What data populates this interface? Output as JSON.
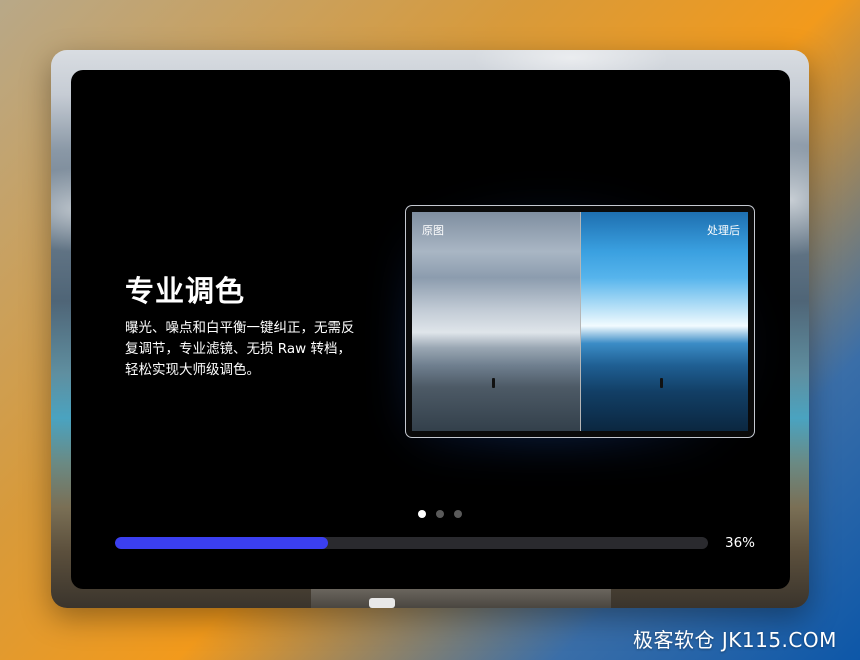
{
  "slide": {
    "title": "专业调色",
    "description": "曝光、噪点和白平衡一键纠正，无需反复调节，专业滤镜、无损 Raw 转档，轻松实现大师级调色。"
  },
  "comparison": {
    "before_label": "原图",
    "after_label": "处理后"
  },
  "carousel": {
    "total": 3,
    "active_index": 0
  },
  "progress": {
    "percent": 36,
    "text": "36%"
  },
  "watermark": {
    "text": "极客软仓 JK115.COM"
  },
  "colors": {
    "accent": "#3b3ff0",
    "panel_background": "#000000",
    "dot_active": "#ffffff",
    "dot_inactive": "#5a5a5a"
  }
}
